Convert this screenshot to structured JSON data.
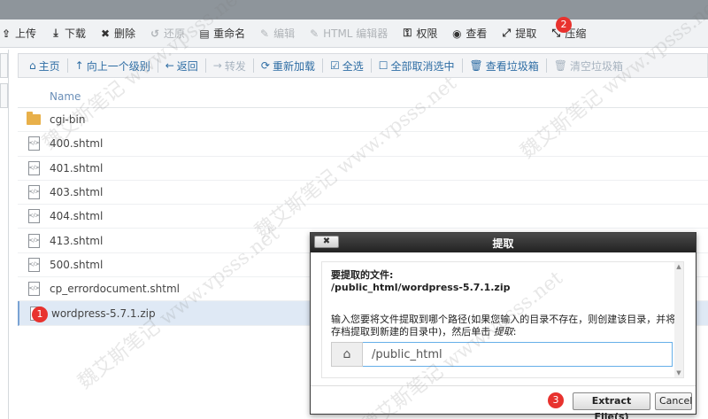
{
  "toolbar": {
    "items": [
      {
        "label": "上传",
        "icon": "upload-icon",
        "glyph": "⇪",
        "enabled": true
      },
      {
        "label": "下载",
        "icon": "download-icon",
        "glyph": "⤓",
        "enabled": true
      },
      {
        "label": "删除",
        "icon": "close-icon",
        "glyph": "✖",
        "enabled": true
      },
      {
        "label": "还原",
        "icon": "undo-icon",
        "glyph": "↺",
        "enabled": false
      },
      {
        "label": "重命名",
        "icon": "rename-icon",
        "glyph": "▤",
        "enabled": true
      },
      {
        "label": "编辑",
        "icon": "pencil-icon",
        "glyph": "✎",
        "enabled": false
      },
      {
        "label": "HTML 编辑器",
        "icon": "html-editor-icon",
        "glyph": "✎",
        "enabled": false
      },
      {
        "label": "权限",
        "icon": "key-icon",
        "glyph": "⚿",
        "enabled": true
      },
      {
        "label": "查看",
        "icon": "eye-icon",
        "glyph": "◉",
        "enabled": true
      },
      {
        "label": "提取",
        "icon": "extract-icon",
        "glyph": "⤢",
        "enabled": true
      },
      {
        "label": "压缩",
        "icon": "compress-icon",
        "glyph": "⤡",
        "enabled": true
      }
    ]
  },
  "subtoolbar": {
    "items": [
      {
        "label": "主页",
        "icon": "home-icon",
        "glyph": "⌂",
        "enabled": true
      },
      {
        "label": "向上一个级别",
        "icon": "level-up-icon",
        "glyph": "↑",
        "enabled": true
      },
      {
        "label": "返回",
        "icon": "arrow-left-icon",
        "glyph": "←",
        "enabled": true
      },
      {
        "label": "转发",
        "icon": "arrow-right-icon",
        "glyph": "→",
        "enabled": false
      },
      {
        "label": "重新加载",
        "icon": "refresh-icon",
        "glyph": "⟳",
        "enabled": true
      },
      {
        "label": "全选",
        "icon": "checkbox-checked-icon",
        "glyph": "☑",
        "enabled": true
      },
      {
        "label": "全部取消选中",
        "icon": "checkbox-empty-icon",
        "glyph": "☐",
        "enabled": true
      },
      {
        "label": "查看垃圾箱",
        "icon": "trash-icon",
        "glyph": "🗑",
        "enabled": true
      },
      {
        "label": "清空垃圾箱",
        "icon": "trash-empty-icon",
        "glyph": "🗑",
        "enabled": false
      }
    ]
  },
  "filelist": {
    "header": "Name",
    "rows": [
      {
        "name": "cgi-bin",
        "type": "folder",
        "selected": false
      },
      {
        "name": "400.shtml",
        "type": "file",
        "selected": false
      },
      {
        "name": "401.shtml",
        "type": "file",
        "selected": false
      },
      {
        "name": "403.shtml",
        "type": "file",
        "selected": false
      },
      {
        "name": "404.shtml",
        "type": "file",
        "selected": false
      },
      {
        "name": "413.shtml",
        "type": "file",
        "selected": false
      },
      {
        "name": "500.shtml",
        "type": "file",
        "selected": false
      },
      {
        "name": "cp_errordocument.shtml",
        "type": "file",
        "selected": false
      },
      {
        "name": "wordpress-5.7.1.zip",
        "type": "zip",
        "selected": true
      }
    ]
  },
  "badges": {
    "one": "1",
    "two": "2",
    "three": "3"
  },
  "dialog": {
    "title": "提取",
    "close_label": "✖",
    "file_label": "要提取的文件:",
    "file_path": "/public_html/wordpress-5.7.1.zip",
    "instruction": "输入您要将文件提取到哪个路径(如果您输入的目录不存在，则创建该目录，并将存档提取到新建的目录中)，然后单击",
    "instruction_em": "提取",
    "instruction_end": ":",
    "input_value": "/public_html",
    "extract_button": "Extract File(s)",
    "cancel_button": "Cancel"
  },
  "watermark": "魏艾斯笔记 www.vpsss.net",
  "colors": {
    "accent": "#2e6da4",
    "badge": "#e8322e",
    "folder": "#e8b04a",
    "selected_row": "#dfe9f5"
  }
}
